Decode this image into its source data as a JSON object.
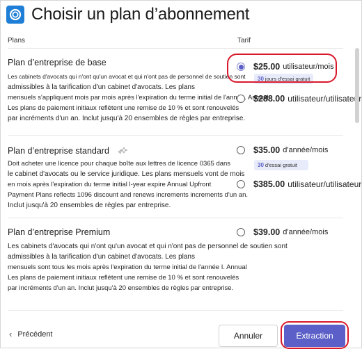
{
  "dialog": {
    "title": "Choisir un plan d’abonnement",
    "app_icon": "app-ring-icon"
  },
  "columns": {
    "plans": "Plans",
    "tarif": "Tarif"
  },
  "plans": [
    {
      "name": "Plan d’entreprise de base",
      "description": [
        "Les cabinets d'avocats qui n'ont qu'un avocat et qui n'ont pas de personnel de soutien sont",
        "admissibles à la tarification d'un cabinet d'avocats. Les plans",
        "mensuels s'appliquent mois par mois après l'expiration du terme initial de l'année. Annual",
        "Les plans de paiement initiaux reflètent une remise de 10 % et sont renouvelés",
        "par incréments d'un an. Inclut jusqu'à 20 ensembles de règles par entreprise."
      ],
      "options": [
        {
          "price": "$25.00",
          "unit": "utilisateur/mois",
          "selected": true,
          "trial": {
            "days": "30",
            "label": "jours d'essai gratuit"
          }
        },
        {
          "price": "$288.00",
          "unit": "utilisateur/utilisateur",
          "selected": false
        }
      ]
    },
    {
      "name": "Plan d’entreprise standard",
      "icon": "sparkle-icon",
      "description": [
        "Doit acheter une licence pour chaque boîte aux lettres de licence 0365 dans",
        "le cabinet d'avocats ou le service juridique.  Les plans mensuels vont de mois",
        "en mois après l'expiration du terme initial l-year expire Annual Upfront",
        "Payment Plans reflects 1096 discount and renews increments increments d'un an.",
        "Inclut jusqu'à 20 ensembles de règles par entreprise."
      ],
      "options": [
        {
          "price": "$35.00",
          "unit": "d'année/mois",
          "selected": false,
          "trial": {
            "days": "30",
            "label": "d'essai gratuit"
          }
        },
        {
          "price": "$385.00",
          "unit": "utilisateur/utilisateur",
          "selected": false
        }
      ]
    },
    {
      "name": "Plan d’entreprise Premium",
      "description": [
        "Les cabinets d'avocats qui n'ont qu'un avocat et qui n'ont pas de personnel de soutien sont",
        "admissibles à la tarification d'un cabinet d'avocats. Les plans",
        "mensuels sont tous les mois après l'expiration du terme initial de l'année I. Annual",
        "Les plans de paiement initiaux reflètent une remise de 10 % et sont renouvelés",
        "par incréments d'un an. Inclut jusqu'à 20 ensembles de règles par entreprise."
      ],
      "options": [
        {
          "price": "$39.00",
          "unit": "d'année/mois",
          "selected": false
        }
      ]
    }
  ],
  "footer": {
    "back_label": "Précédent",
    "cancel_label": "Annuler",
    "primary_label": "Extraction"
  },
  "colors": {
    "accent": "#5b5fc7",
    "highlight": "#d8182a",
    "trial_bg": "#e8ebfa",
    "app_icon": "#1f7fd6"
  }
}
